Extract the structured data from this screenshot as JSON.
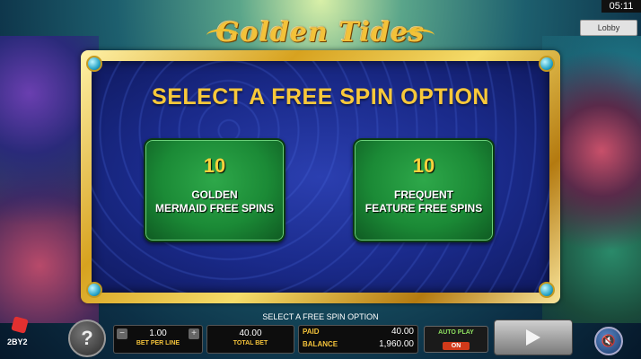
{
  "clock": "05:11",
  "lobby_label": "Lobby",
  "logo_text": "Golden Tides",
  "title": "SELECT A FREE SPIN OPTION",
  "options": [
    {
      "count": "10",
      "label_line1": "GOLDEN",
      "label_line2": "MERMAID FREE SPINS"
    },
    {
      "count": "10",
      "label_line1": "FREQUENT",
      "label_line2": "FEATURE FREE SPINS"
    }
  ],
  "status_message": "SELECT A FREE SPIN OPTION",
  "help_icon": "?",
  "bet_per_line": {
    "value": "1.00",
    "caption": "BET PER LINE",
    "minus": "−",
    "plus": "+"
  },
  "total_bet": {
    "value": "40.00",
    "caption": "TOTAL BET"
  },
  "paid": {
    "label": "PAID",
    "value": "40.00"
  },
  "balance": {
    "label": "BALANCE",
    "value": "1,960.00"
  },
  "auto_play": {
    "label": "AUTO PLAY",
    "state": "ON"
  },
  "brand": "2BY2",
  "sound_icon": "🔇"
}
